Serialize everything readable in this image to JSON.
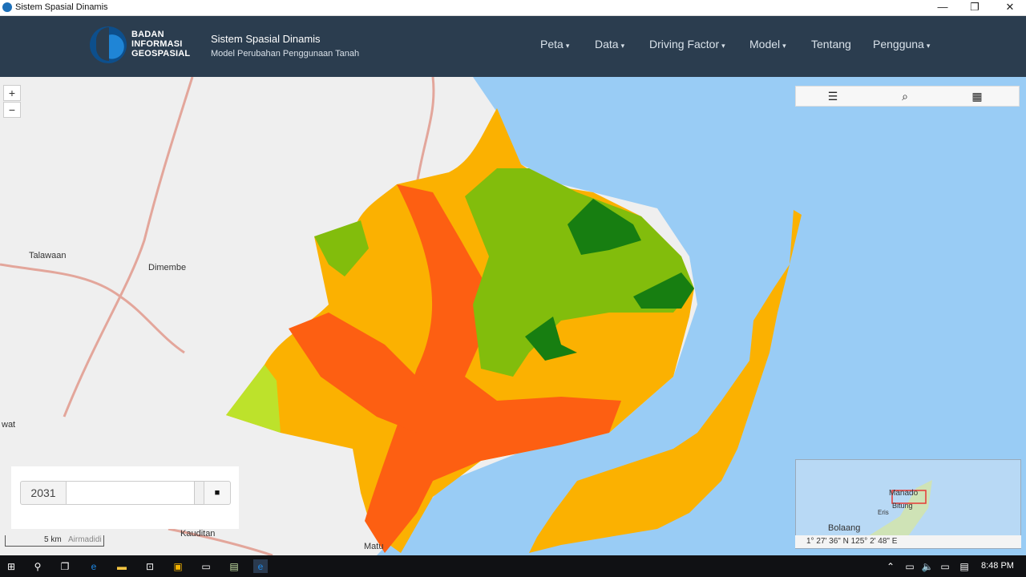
{
  "window": {
    "title": "Sistem Spasial Dinamis",
    "controls": [
      "—",
      "❐",
      "✕"
    ]
  },
  "header": {
    "logo_lines": [
      "BADAN",
      "INFORMASI",
      "GEOSPASIAL"
    ],
    "app_name": "Sistem Spasial Dinamis",
    "app_subtitle": "Model Perubahan Penggunaan Tanah",
    "menu": [
      {
        "label": "Peta",
        "caret": "▾"
      },
      {
        "label": "Data",
        "caret": "▾"
      },
      {
        "label": "Driving Factor",
        "caret": "▾"
      },
      {
        "label": "Model",
        "caret": "▾"
      },
      {
        "label": "Tentang",
        "caret": ""
      },
      {
        "label": "Pengguna",
        "caret": "▾"
      }
    ]
  },
  "map": {
    "zoom_in": "+",
    "zoom_out": "−",
    "toolbar": {
      "list_icon": "☰",
      "search_icon": "⌕",
      "grid_icon": "▦"
    },
    "places": [
      "Talawaan",
      "Dimembe",
      "Kauditan",
      "Matu",
      "wat",
      "Airmadidi"
    ],
    "overview_places": [
      "Manado",
      "Bitung",
      "Eris",
      "Bolaang"
    ],
    "coordinates": "1° 27' 36\" N 125° 2' 48\" E",
    "scale": "5 km"
  },
  "timeline": {
    "year": "2031",
    "stop_icon": "■"
  },
  "taskbar": {
    "time": "8:48 PM"
  },
  "colors": {
    "sea": "#99ccf5",
    "orange": "#fbb101",
    "red_orange": "#fd5f12",
    "light_green": "#82bd0c",
    "dark_green": "#177e11",
    "yellow_green": "#bde22b",
    "navbar": "#2b3d4f"
  }
}
